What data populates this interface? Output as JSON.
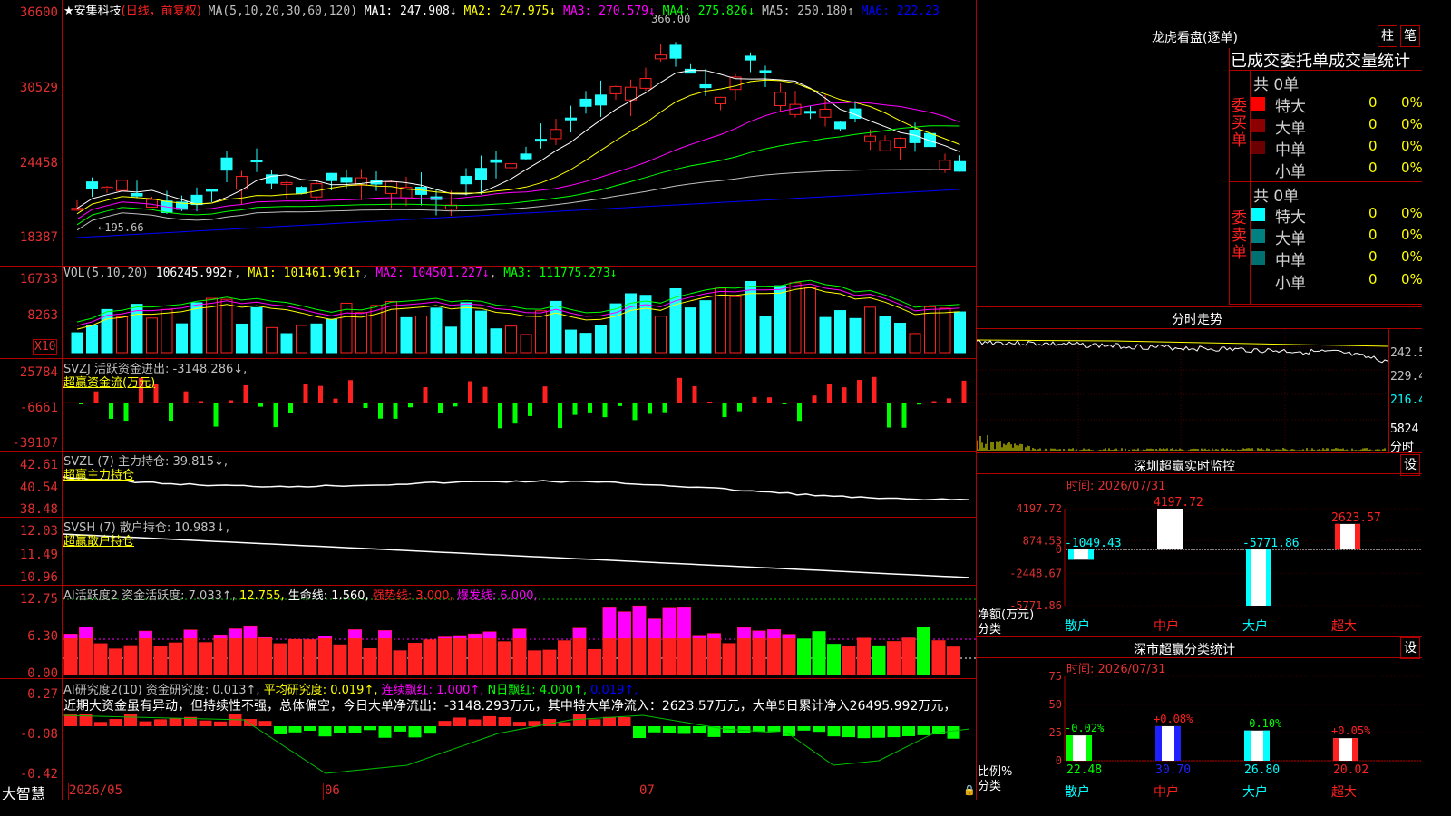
{
  "header": {
    "star": "★",
    "stock_name": "安集科技",
    "period": "(日线，前复权)",
    "ma_label": "MA(5,10,20,30,60,120)",
    "ma1": "MA1: 247.908↓",
    "ma2": "MA2: 247.975↓",
    "ma3": "MA3: 270.579↓",
    "ma4": "MA4: 275.826↓",
    "ma5": "MA5: 250.180↑",
    "ma6": "MA6: 222.23"
  },
  "colors": {
    "up": "#ff2020",
    "down": "#20ffff",
    "ma1": "#ffffff",
    "ma2": "#ffff00",
    "ma3": "#ff00ff",
    "ma4": "#00ff00",
    "ma5": "#c0c0c0",
    "ma6": "#0000ff",
    "grid": "#b00000"
  },
  "price_axis": [
    "36600",
    "30529",
    "24458",
    "18387"
  ],
  "price_markers": {
    "high": "366.00",
    "low": "195.66"
  },
  "vol": {
    "label": "VOL(5,10,20)",
    "value": "106245.992↑",
    "ma1": "MA1: 101461.961↑",
    "ma2": "MA2: 104501.227↓",
    "ma3": "MA3: 111775.273↓",
    "axis": [
      "16733",
      "8263"
    ],
    "unit": "X10"
  },
  "svzj": {
    "label": "SVZJ  活跃资金进出: -3148.286↓,",
    "sub": "超赢资金流(万元)",
    "axis": [
      "25784",
      "-6661",
      "-39107"
    ]
  },
  "svzl": {
    "label": "SVZL (7) 主力持仓: 39.815↓,",
    "sub": "超赢主力持仓",
    "axis": [
      "42.61",
      "40.54",
      "38.48"
    ]
  },
  "svsh": {
    "label": "SVSH (7) 散户持仓: 10.983↓,",
    "sub": "超赢散户持仓",
    "axis": [
      "12.03",
      "11.49",
      "10.96"
    ]
  },
  "ai_active": {
    "label": "AI活跃度2 资金活跃度: 7.033↑,",
    "v2": "12.755,",
    "v3": "生命线: 1.560,",
    "v4": "强势线: 3.000,",
    "v5": "爆发线: 6.000,",
    "axis": [
      "12.75",
      "6.30",
      "0.00"
    ]
  },
  "ai_research": {
    "label": "AI研究度2(10) 资金研究度: 0.013↑,",
    "v2": "平均研究度: 0.019↑,",
    "v3": "连续飘红: 1.000↑,",
    "v4": "N日飘红: 4.000↑,",
    "v5": "0.019↑,",
    "note": "近期大资金虽有异动，但持续性不强，总体偏空，今日大单净流出：-3148.293万元，其中特大单净流入：2623.57万元，大单5日累计净入26495.992万元，",
    "axis": [
      "0.27",
      "-0.08",
      "-0.42"
    ]
  },
  "bottom": {
    "app_name": "大智慧",
    "dates": [
      "2026/05",
      "06",
      "07"
    ]
  },
  "dragon": {
    "title": "龙虎看盘(逐单)",
    "btn1": "柱",
    "btn2": "笔",
    "sub": "已成交委托单成交量统计",
    "buy_label": "委买单",
    "sell_label": "委卖单",
    "buy_total": "共 0单",
    "sell_total": "共 0单",
    "buy_rows": [
      {
        "name": "特大",
        "count": "0",
        "pct": "0%",
        "color": "#ff0000"
      },
      {
        "name": "大单",
        "count": "0",
        "pct": "0%",
        "color": "#8b0000"
      },
      {
        "name": "中单",
        "count": "0",
        "pct": "0%",
        "color": "#6b0000"
      },
      {
        "name": "小单",
        "count": "0",
        "pct": "0%",
        "color": "#000000"
      }
    ],
    "sell_rows": [
      {
        "name": "特大",
        "count": "0",
        "pct": "0%",
        "color": "#00ffff"
      },
      {
        "name": "大单",
        "count": "0",
        "pct": "0%",
        "color": "#008080"
      },
      {
        "name": "中单",
        "count": "0",
        "pct": "0%",
        "color": "#007070"
      },
      {
        "name": "小单",
        "count": "0",
        "pct": "0%",
        "color": "#000000"
      }
    ]
  },
  "intraday": {
    "title": "分时走势",
    "axis": [
      "242.5",
      "229.4",
      "216.4"
    ],
    "vol": "5824",
    "vol_label": "分时"
  },
  "sz_monitor": {
    "title": "深圳超赢实时监控",
    "btn": "设",
    "time": "时间: 2026/07/31",
    "axis": [
      "4197.72",
      "874.53",
      "0",
      "-2448.67",
      "-5771.86"
    ],
    "unit": "净额(万元)",
    "unit2": "分类",
    "categories": [
      "散户",
      "中户",
      "大户",
      "超大"
    ]
  },
  "sz_class": {
    "title": "深市超赢分类统计",
    "btn": "设",
    "time": "时间: 2026/07/31",
    "axis": [
      "75",
      "50",
      "25",
      "0"
    ],
    "unit": "比例%",
    "unit2": "分类",
    "categories": [
      "散户",
      "中户",
      "大户",
      "超大"
    ]
  },
  "chart_data": [
    {
      "type": "bar",
      "title": "深圳超赢实时监控",
      "ylabel": "净额(万元)",
      "categories": [
        "散户",
        "中户",
        "大户",
        "超大"
      ],
      "values": [
        -1049.43,
        4197.72,
        -5771.86,
        2623.57
      ],
      "ylim": [
        -5771.86,
        4197.72
      ]
    },
    {
      "type": "bar",
      "title": "深市超赢分类统计",
      "ylabel": "比例%",
      "categories": [
        "散户",
        "中户",
        "大户",
        "超大"
      ],
      "values": [
        22.48,
        30.7,
        26.8,
        20.02
      ],
      "changes": [
        "-0.02%",
        "+0.08%",
        "-0.10%",
        "+0.05%"
      ],
      "ylim": [
        0,
        75
      ]
    }
  ]
}
